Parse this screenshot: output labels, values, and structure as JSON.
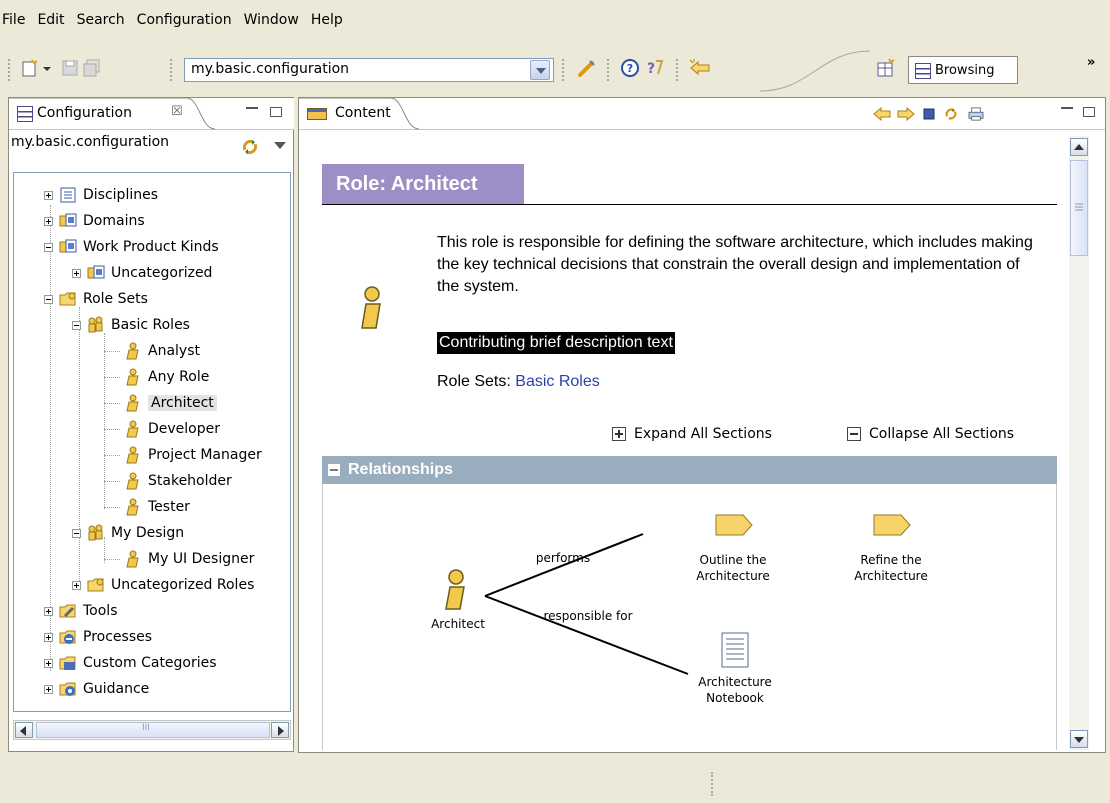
{
  "menu": {
    "items": [
      "File",
      "Edit",
      "Search",
      "Configuration",
      "Window",
      "Help"
    ]
  },
  "toolbar": {
    "config_combo_value": "my.basic.configuration",
    "perspective_label": "Browsing",
    "more_label": "»"
  },
  "left_panel": {
    "tab_title": "Configuration",
    "tab_close": "☒",
    "config_name": "my.basic.configuration",
    "tree": [
      {
        "label": "Disciplines"
      },
      {
        "label": "Domains"
      },
      {
        "label": "Work Product Kinds"
      },
      {
        "label": "Uncategorized"
      },
      {
        "label": "Role Sets"
      },
      {
        "label": "Basic Roles"
      },
      {
        "label": "Analyst"
      },
      {
        "label": "Any Role"
      },
      {
        "label": "Architect"
      },
      {
        "label": "Developer"
      },
      {
        "label": "Project Manager"
      },
      {
        "label": "Stakeholder"
      },
      {
        "label": "Tester"
      },
      {
        "label": "My Design"
      },
      {
        "label": "My UI Designer"
      },
      {
        "label": "Uncategorized Roles"
      },
      {
        "label": "Tools"
      },
      {
        "label": "Processes"
      },
      {
        "label": "Custom Categories"
      },
      {
        "label": "Guidance"
      }
    ],
    "scroll_grip": "III"
  },
  "right_panel": {
    "tab_title": "Content",
    "page_title": "Role: Architect",
    "description": "This role is responsible for defining the software architecture, which includes making the key technical decisions that constrain the overall design and implementation of the system.",
    "contributing_text": "Contributing brief description text",
    "role_sets_label": "Role Sets:",
    "role_sets_link": "Basic Roles",
    "expand_all": "Expand All Sections",
    "collapse_all": "Collapse All Sections",
    "relationships_title": "Relationships",
    "diagram": {
      "role_label": "Architect",
      "performs_label": "performs",
      "responsible_label": "responsible for",
      "task1": [
        "Outline the",
        "Architecture"
      ],
      "task2": [
        "Refine the",
        "Architecture"
      ],
      "work_product": [
        "Architecture",
        "Notebook"
      ]
    }
  },
  "colors": {
    "role_banner": "#9c8fc6",
    "relationships_bar": "#9aadbf",
    "link": "#2942a8",
    "role_figure": "#f2c94c",
    "task_icon": "#f5d56a"
  }
}
